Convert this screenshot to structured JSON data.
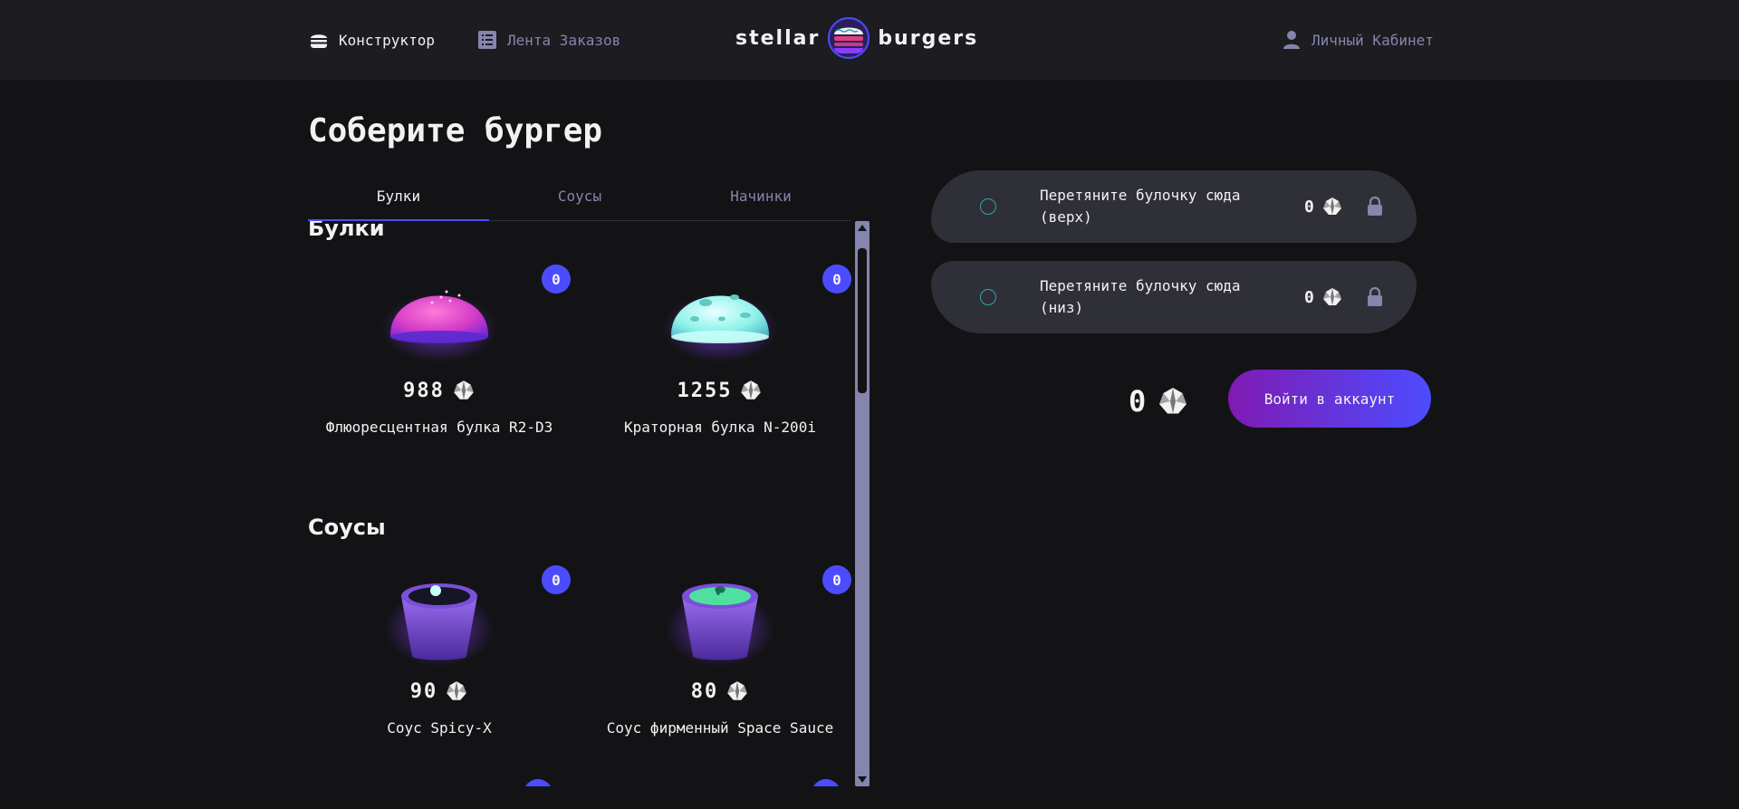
{
  "header": {
    "constructor_label": "Конструктор",
    "feed_label": "Лента Заказов",
    "logo_left": "stellar",
    "logo_right": "burgers",
    "cabinet_label": "Личный Кабинет"
  },
  "page_title": "Соберите бургер",
  "tabs": [
    {
      "label": "Булки",
      "active": true
    },
    {
      "label": "Соусы",
      "active": false
    },
    {
      "label": "Начинки",
      "active": false
    }
  ],
  "sections": {
    "buns": {
      "title": "Булки",
      "items": [
        {
          "name": "Флюоресцентная булка R2-D3",
          "price": "988",
          "count": "0"
        },
        {
          "name": "Краторная булка N-200i",
          "price": "1255",
          "count": "0"
        }
      ]
    },
    "sauces": {
      "title": "Соусы",
      "items": [
        {
          "name": "Соус Spicy-X",
          "price": "90",
          "count": "0"
        },
        {
          "name": "Соус фирменный Space Sauce",
          "price": "80",
          "count": "0"
        }
      ]
    }
  },
  "constructor": {
    "top_slot": {
      "line1": "Перетяните булочку сюда",
      "line2": "(верх)",
      "price": "0"
    },
    "bottom_slot": {
      "line1": "Перетяните булочку сюда",
      "line2": "(низ)",
      "price": "0"
    },
    "total": "0",
    "login_button": "Войти в аккаунт"
  },
  "colors": {
    "accent": "#4c4cff",
    "inactive_text": "#8585ad",
    "background": "#131316",
    "header_bg": "#1c1c21",
    "slot_bg": "#2f2f37"
  },
  "icons": [
    "burger-icon",
    "list-icon",
    "profile-icon",
    "currency-icon",
    "lock-icon"
  ]
}
